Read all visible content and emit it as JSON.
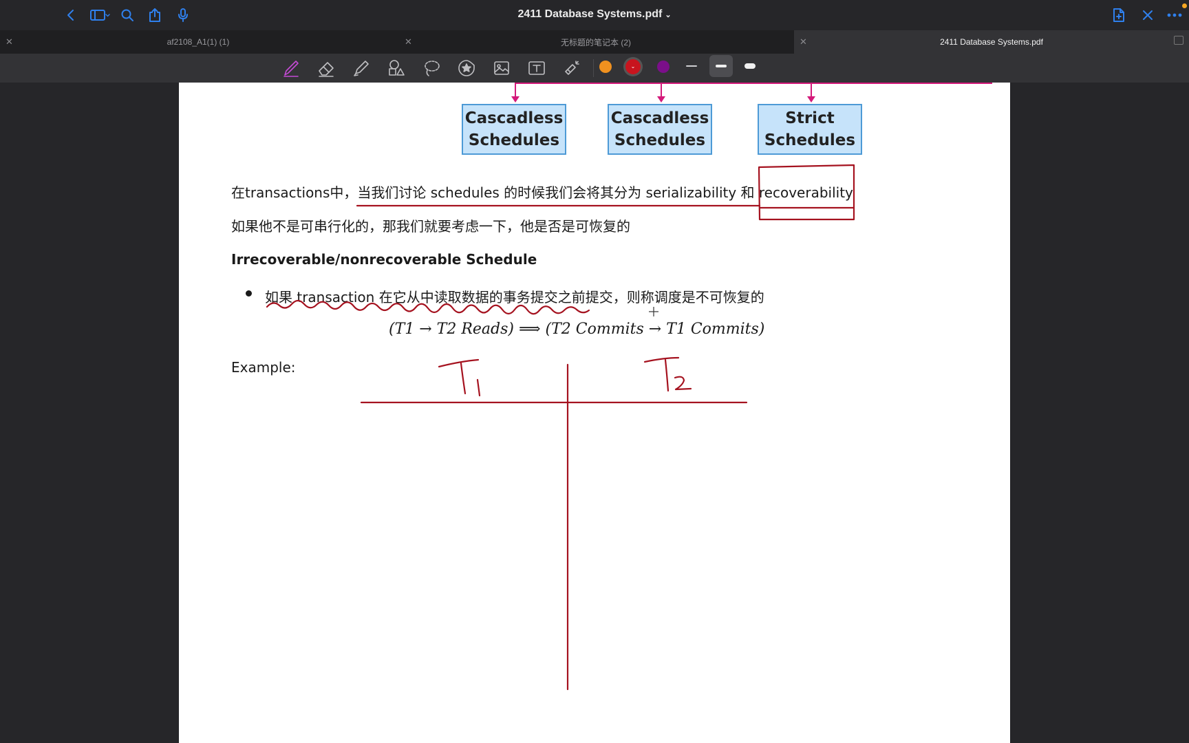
{
  "window": {
    "title": "2411 Database Systems.pdf"
  },
  "tabs": [
    {
      "label": "af2108_A1(1) (1)",
      "active": false
    },
    {
      "label": "无标题的笔记本 (2)",
      "active": false
    },
    {
      "label": "2411 Database Systems.pdf",
      "active": true
    }
  ],
  "toolbar": {
    "tools": [
      "pen-icon",
      "eraser-icon",
      "highlighter-icon",
      "shapes-icon",
      "lasso-icon",
      "sticker-icon",
      "image-icon",
      "text-box-icon",
      "laser-pointer-icon"
    ],
    "colors": [
      "#f0911f",
      "#c8141e",
      "#7b0f8a"
    ],
    "selected_color": "#c8141e",
    "stroke_widths": [
      "thin",
      "medium",
      "thick"
    ],
    "selected_width": "medium"
  },
  "document": {
    "boxes": [
      "Cascadless\nSchedules",
      "Cascadless\nSchedules",
      "Strict\nSchedules"
    ],
    "para1": "在transactions中，当我们讨论 schedules 的时候我们会将其分为 serializability 和 recoverability",
    "para2": "如果他不是可串行化的，那我们就要考虑一下，他是否是可恢复的",
    "heading": "Irrecoverable/nonrecoverable Schedule",
    "bullet1": "如果 transaction 在它从中读取数据的事务提交之前提交，则称调度是不可恢复的",
    "formula": "(T1 → T2 Reads) ⟹ (T2 Commits → T1 Commits)",
    "example_label": "Example:"
  },
  "annotations": {
    "ink_color": "#a5121f",
    "handwritten_labels": [
      "T1",
      "T2"
    ]
  }
}
